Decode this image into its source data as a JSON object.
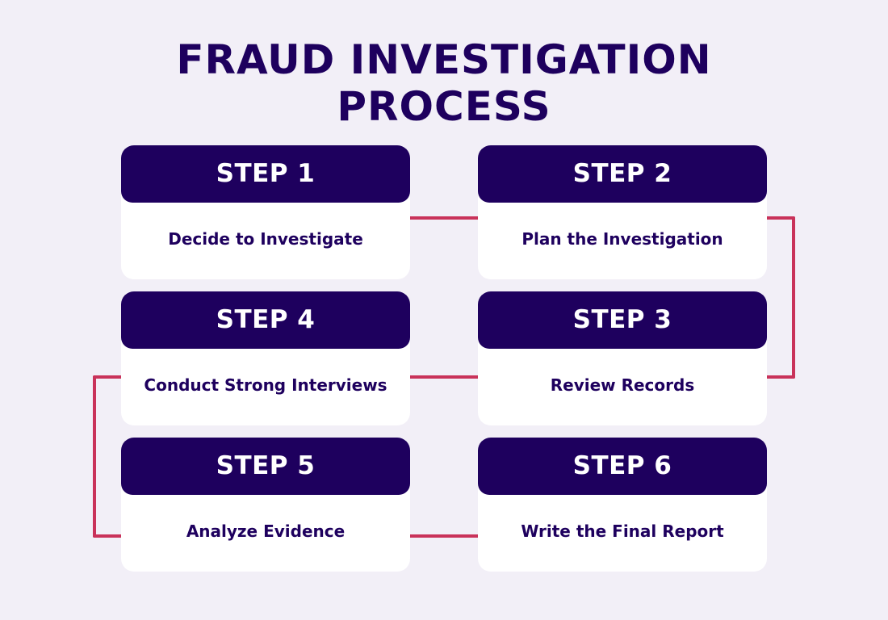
{
  "title": {
    "line1": "FRAUD INVESTIGATION",
    "line2": "PROCESS"
  },
  "colors": {
    "background": "#f2eff7",
    "header": "#1e005e",
    "card": "#ffffff",
    "connector": "#c9325a"
  },
  "steps": [
    {
      "label": "STEP 1",
      "text": "Decide to Investigate"
    },
    {
      "label": "STEP 2",
      "text": "Plan the Investigation"
    },
    {
      "label": "STEP 3",
      "text": "Review Records"
    },
    {
      "label": "STEP 4",
      "text": "Conduct Strong Interviews"
    },
    {
      "label": "STEP 5",
      "text": "Analyze Evidence"
    },
    {
      "label": "STEP 6",
      "text": "Write the Final Report"
    }
  ]
}
